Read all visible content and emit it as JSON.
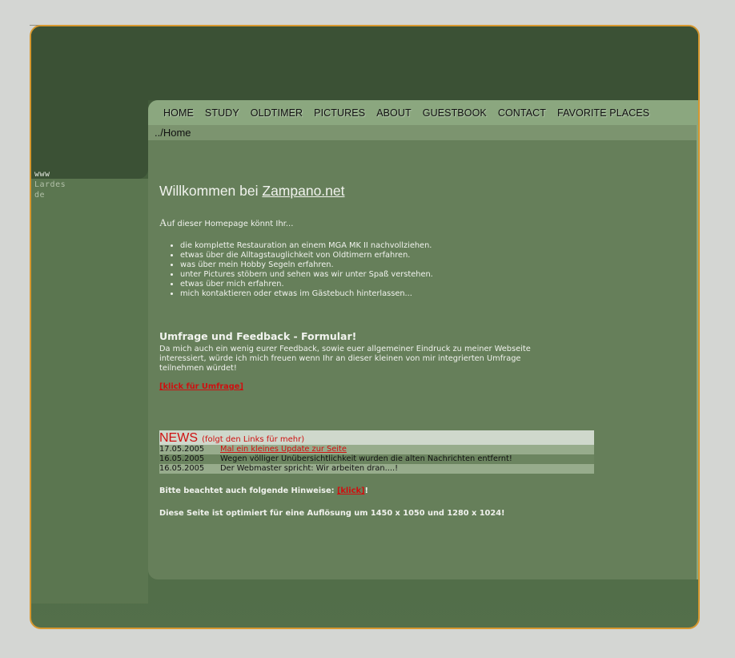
{
  "nav": {
    "items": [
      "HOME",
      "STUDY",
      "OLDTIMER",
      "PICTURES",
      "ABOUT",
      "GUESTBOOK",
      "CONTACT",
      "FAVORITE PLACES"
    ]
  },
  "breadcrumb": "../Home",
  "sidebar": {
    "line1": "www",
    "line2": "Lardes",
    "line3": "de"
  },
  "welcome": {
    "prefix": "Willkommen bei ",
    "link": "Zampano.net"
  },
  "intro": {
    "first_letter": "A",
    "rest": "uf dieser Homepage könnt Ihr..."
  },
  "list_items": [
    "die komplette Restauration an einem MGA MK II nachvollziehen.",
    "etwas über die Alltagstauglichkeit von Oldtimern erfahren.",
    "was über mein Hobby Segeln erfahren.",
    "unter Pictures stöbern und sehen was wir unter Spaß verstehen.",
    "etwas über mich erfahren.",
    "mich kontaktieren oder etwas im Gästebuch hinterlassen..."
  ],
  "survey": {
    "heading": "Umfrage und Feedback - Formular!",
    "text": "Da mich auch ein wenig eurer Feedback, sowie euer allgemeiner Eindruck zu meiner Webseite interessiert, würde ich mich freuen wenn Ihr an dieser kleinen von mir integrierten Umfrage teilnehmen würdet!",
    "link": "[klick für Umfrage]"
  },
  "news": {
    "title": "NEWS",
    "subtitle": "(folgt den Links für mehr)",
    "rows": [
      {
        "date": "17.05.2005",
        "text": "Mal ein kleines Update zur Seite"
      },
      {
        "date": "16.05.2005",
        "text": "Wegen völliger Unübersichtlichkeit wurden die alten Nachrichten entfernt!"
      },
      {
        "date": "16.05.2005",
        "text": "Der Webmaster spricht: Wir arbeiten dran....!"
      }
    ]
  },
  "hint": {
    "prefix": "Bitte beachtet auch folgende Hinweise: ",
    "link": "[klick]",
    "suffix": "!"
  },
  "optimized": "Diese Seite ist optimiert für eine Auflösung um 1450 x  1050 und 1280 x 1024!",
  "colors": {
    "accent": "#d7982f",
    "link_red": "#cf1010",
    "nav_bg": "#8ba77f"
  }
}
